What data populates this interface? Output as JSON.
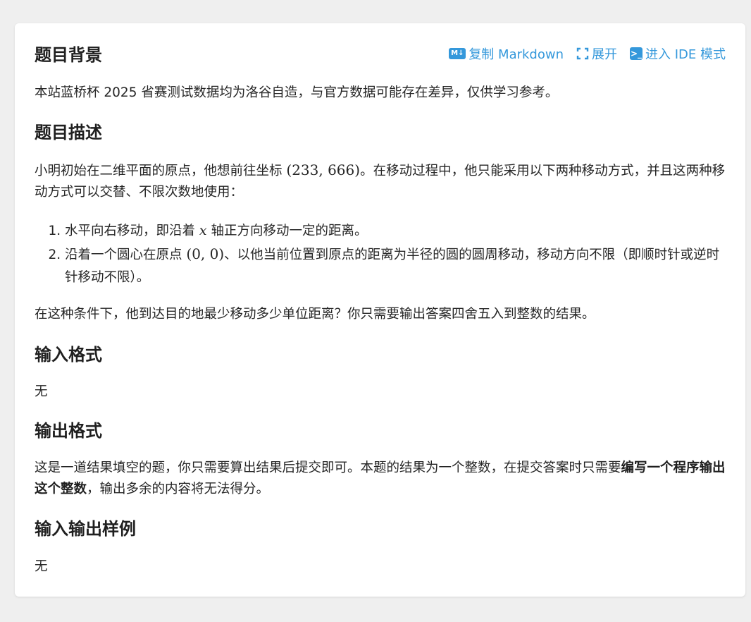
{
  "toolbar": {
    "copy_markdown": "复制 Markdown",
    "expand": "展开",
    "ide_mode": "进入 IDE 模式",
    "md_icon_text": "M↓",
    "ide_icon_text": ">_"
  },
  "background": {
    "title": "题目背景",
    "text": "本站蓝桥杯 2025 省赛测试数据均为洛谷自造，与官方数据可能存在差异，仅供学习参考。"
  },
  "description": {
    "title": "题目描述",
    "para_part1": "小明初始在二维平面的原点，他想前往坐标 ",
    "para_math": "(233, 666)",
    "para_part2": "。在移动过程中，他只能采用以下两种移动方式，并且这两种移动方式可以交替、不限次数地使用：",
    "item1_part1": "水平向右移动，即沿着 ",
    "item1_math": "x",
    "item1_part2": " 轴正方向移动一定的距离。",
    "item2_part1": "沿着一个圆心在原点 ",
    "item2_math": "(0, 0)",
    "item2_part2": "、以他当前位置到原点的距离为半径的圆的圆周移动，移动方向不限（即顺时针或逆时针移动不限）。",
    "question": "在这种条件下，他到达目的地最少移动多少单位距离？你只需要输出答案四舍五入到整数的结果。"
  },
  "input_format": {
    "title": "输入格式",
    "text": "无"
  },
  "output_format": {
    "title": "输出格式",
    "text_part1": "这是一道结果填空的题，你只需要算出结果后提交即可。本题的结果为一个整数，在提交答案时只需要",
    "text_bold": "编写一个程序输出这个整数",
    "text_part2": "，输出多余的内容将无法得分。"
  },
  "samples": {
    "title": "输入输出样例",
    "text": "无"
  }
}
